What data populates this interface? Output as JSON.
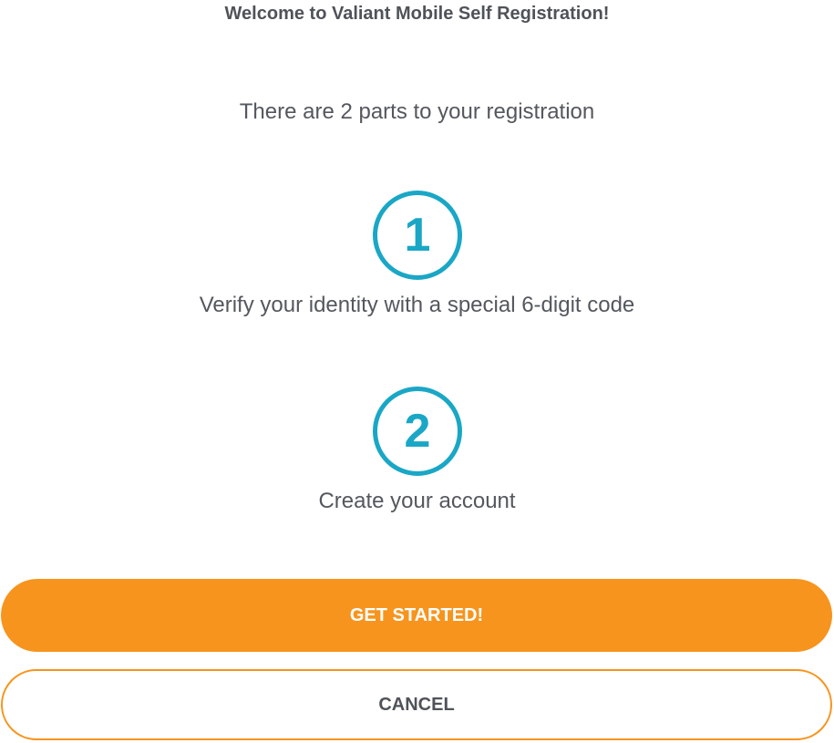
{
  "header": {
    "title": "Welcome to Valiant Mobile Self Registration!",
    "subtitle": "There are 2 parts to your registration"
  },
  "steps": [
    {
      "number": "1",
      "label": "Verify your identity with a special 6-digit code"
    },
    {
      "number": "2",
      "label": "Create your account"
    }
  ],
  "actions": {
    "primary_label": "GET STARTED!",
    "secondary_label": "CANCEL"
  },
  "colors": {
    "accent": "#f7941d",
    "step_circle": "#1aa7c6",
    "text": "#54585e"
  }
}
